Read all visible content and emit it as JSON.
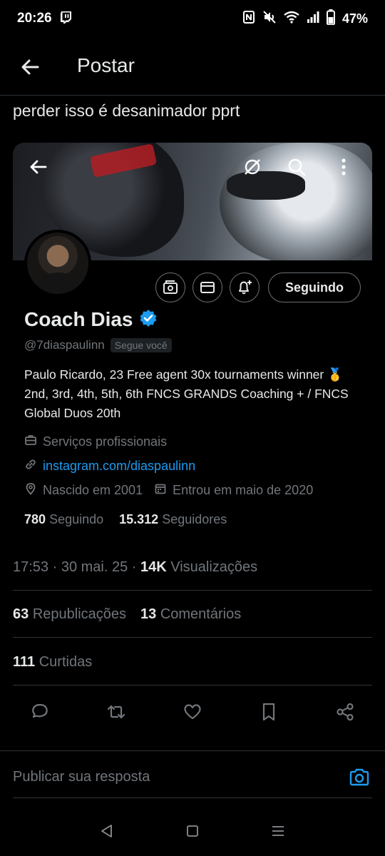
{
  "status_bar": {
    "time": "20:26",
    "battery": "47%",
    "icons": [
      "twitch-icon",
      "nfc-icon",
      "mute-icon",
      "wifi-icon",
      "signal-icon",
      "battery-icon"
    ]
  },
  "header": {
    "title": "Postar"
  },
  "post": {
    "text": "perder isso é desanimador pprt"
  },
  "profile": {
    "name": "Coach Dias",
    "handle": "@7diaspaulinn",
    "follows_you": "Segue você",
    "following_button": "Seguindo",
    "bio": "Paulo Ricardo, 23 Free agent 30x tournaments winner 🥇 2nd, 3rd, 4th, 5th, 6th FNCS GRANDS Coaching + / FNCS Global Duos 20th",
    "professional": "Serviços profissionais",
    "link": "instagram.com/diaspaulinn",
    "born": "Nascido em 2001",
    "joined": "Entrou em maio de 2020",
    "following_count": "780",
    "following_label": "Seguindo",
    "followers_count": "15.312",
    "followers_label": "Seguidores"
  },
  "meta": {
    "time_date": "17:53 · 30 mai. 25 · ",
    "views_count": "14K",
    "views_label": "Visualizações"
  },
  "stats": {
    "reposts_count": "63",
    "reposts_label": "Republicações",
    "comments_count": "13",
    "comments_label": "Comentários",
    "likes_count": "111",
    "likes_label": "Curtidas"
  },
  "reply": {
    "placeholder": "Publicar sua resposta"
  },
  "colors": {
    "background": "#000000",
    "text": "#e7e9ea",
    "muted": "#71767b",
    "link": "#1d9bf0",
    "divider": "#2f3336"
  }
}
